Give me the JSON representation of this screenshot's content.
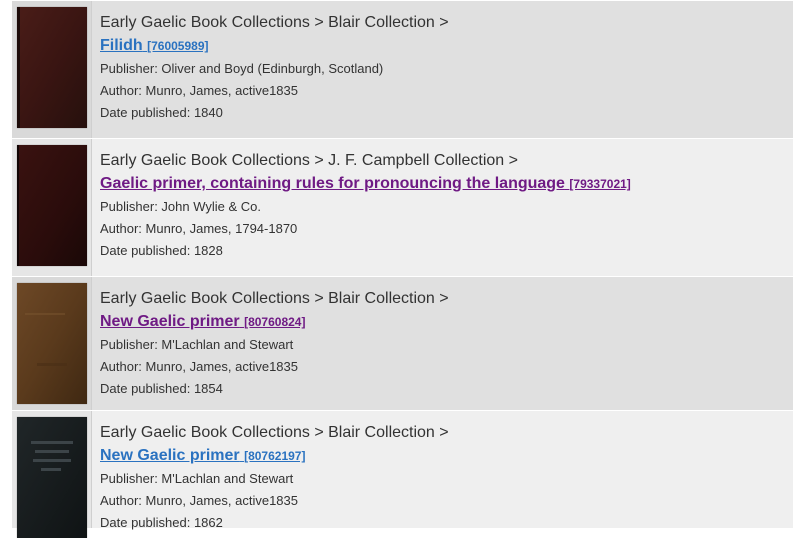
{
  "results": [
    {
      "breadcrumb": "Early Gaelic Book Collections > Blair Collection >",
      "title": "Filidh",
      "id": "[76005989]",
      "publisher": "Publisher: Oliver and Boyd (Edinburgh, Scotland)",
      "author": "Author: Munro, James, active1835",
      "date": "Date published: 1840",
      "link_state": "unvisited",
      "cover_color": "#3a1512"
    },
    {
      "breadcrumb": "Early Gaelic Book Collections > J. F. Campbell Collection >",
      "title": "Gaelic primer, containing rules for pronouncing the language",
      "id": "[79337021]",
      "publisher": "Publisher: John Wylie & Co.",
      "author": "Author: Munro, James, 1794-1870",
      "date": "Date published: 1828",
      "link_state": "visited",
      "cover_color": "#2a0c0b"
    },
    {
      "breadcrumb": "Early Gaelic Book Collections > Blair Collection >",
      "title": "New Gaelic primer",
      "id": "[80760824]",
      "publisher": "Publisher: M'Lachlan and Stewart",
      "author": "Author: Munro, James, active1835",
      "date": "Date published: 1854",
      "link_state": "visited",
      "cover_color": "#5a3a1c"
    },
    {
      "breadcrumb": "Early Gaelic Book Collections > Blair Collection >",
      "title": "New Gaelic primer",
      "id": "[80762197]",
      "publisher": "Publisher: M'Lachlan and Stewart",
      "author": "Author: Munro, James, active1835",
      "date": "Date published: 1862",
      "link_state": "unvisited",
      "cover_color": "#151a1c"
    }
  ]
}
